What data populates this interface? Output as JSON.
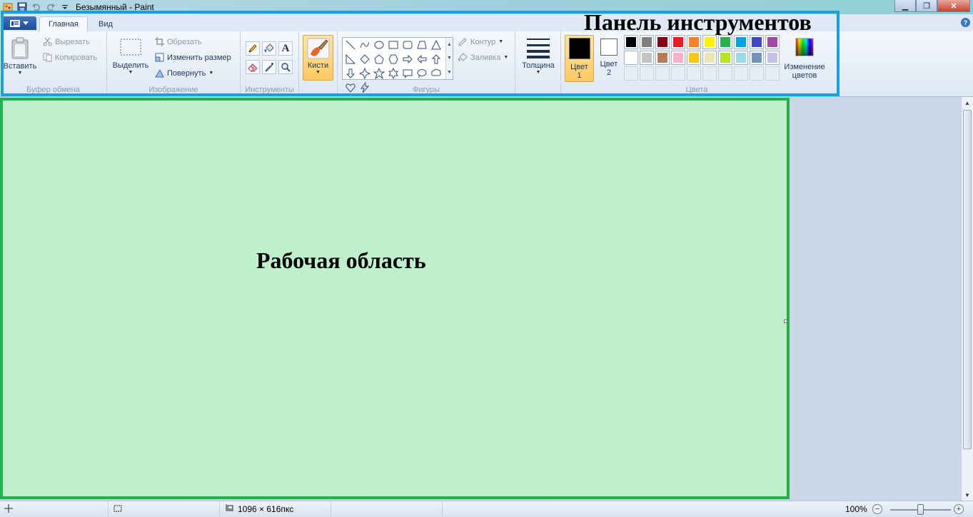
{
  "window": {
    "title": "Безымянный - Paint",
    "controls": [
      "minimize",
      "maximize",
      "close"
    ]
  },
  "tabs": [
    {
      "label": "Главная",
      "active": true
    },
    {
      "label": "Вид",
      "active": false
    }
  ],
  "ribbon": {
    "clipboard": {
      "label": "Буфер обмена",
      "paste": "Вставить",
      "cut": "Вырезать",
      "copy": "Копировать"
    },
    "image": {
      "label": "Изображение",
      "select": "Выделить",
      "crop": "Обрезать",
      "resize": "Изменить размер",
      "rotate": "Повернуть"
    },
    "tools": {
      "label": "Инструменты",
      "items": [
        "pencil-icon",
        "fill-icon",
        "text-icon",
        "eraser-icon",
        "color-picker-icon",
        "magnifier-icon"
      ],
      "text_glyph": "A"
    },
    "brushes": {
      "label": "Кисти"
    },
    "shapes": {
      "label": "Фигуры",
      "outline": "Контур",
      "fill": "Заливка",
      "items": [
        "line",
        "curve",
        "oval",
        "rectangle",
        "rounded-rectangle",
        "polygon",
        "triangle",
        "right-triangle",
        "diamond",
        "pentagon",
        "hexagon",
        "right-arrow",
        "left-arrow",
        "up-arrow",
        "down-arrow",
        "four-point-star",
        "five-point-star",
        "six-point-star",
        "rounded-callout",
        "oval-callout",
        "cloud-callout",
        "heart",
        "lightning"
      ]
    },
    "size": {
      "label": "Толщина"
    },
    "colors": {
      "label": "Цвета",
      "color1_line1": "Цвет",
      "color1_line2": "1",
      "color2_line1": "Цвет",
      "color2_line2": "2",
      "color1_value": "#000000",
      "color2_value": "#ffffff",
      "edit_line1": "Изменение",
      "edit_line2": "цветов",
      "palette_row1": [
        "#000000",
        "#7f7f7f",
        "#880015",
        "#ed1c24",
        "#ff7f27",
        "#fff200",
        "#22b14c",
        "#00a2e8",
        "#3f48cc",
        "#a349a4"
      ],
      "palette_row2": [
        "#ffffff",
        "#c3c3c3",
        "#b97a57",
        "#ffaec9",
        "#ffc90e",
        "#efe4b0",
        "#b5e61d",
        "#99d9ea",
        "#7092be",
        "#c8bfe7"
      ],
      "palette_row3_count": 10
    }
  },
  "annotations": {
    "ribbon_label": "Панель инструментов",
    "canvas_label": "Рабочая область",
    "ribbon_color": "#1aa0dc",
    "canvas_color": "#22b14c"
  },
  "canvas": {
    "fill": "#bff0cc"
  },
  "statusbar": {
    "dimensions": "1096 × 616пкс",
    "zoom": "100%",
    "zoom_minus": "−",
    "zoom_plus": "+"
  }
}
